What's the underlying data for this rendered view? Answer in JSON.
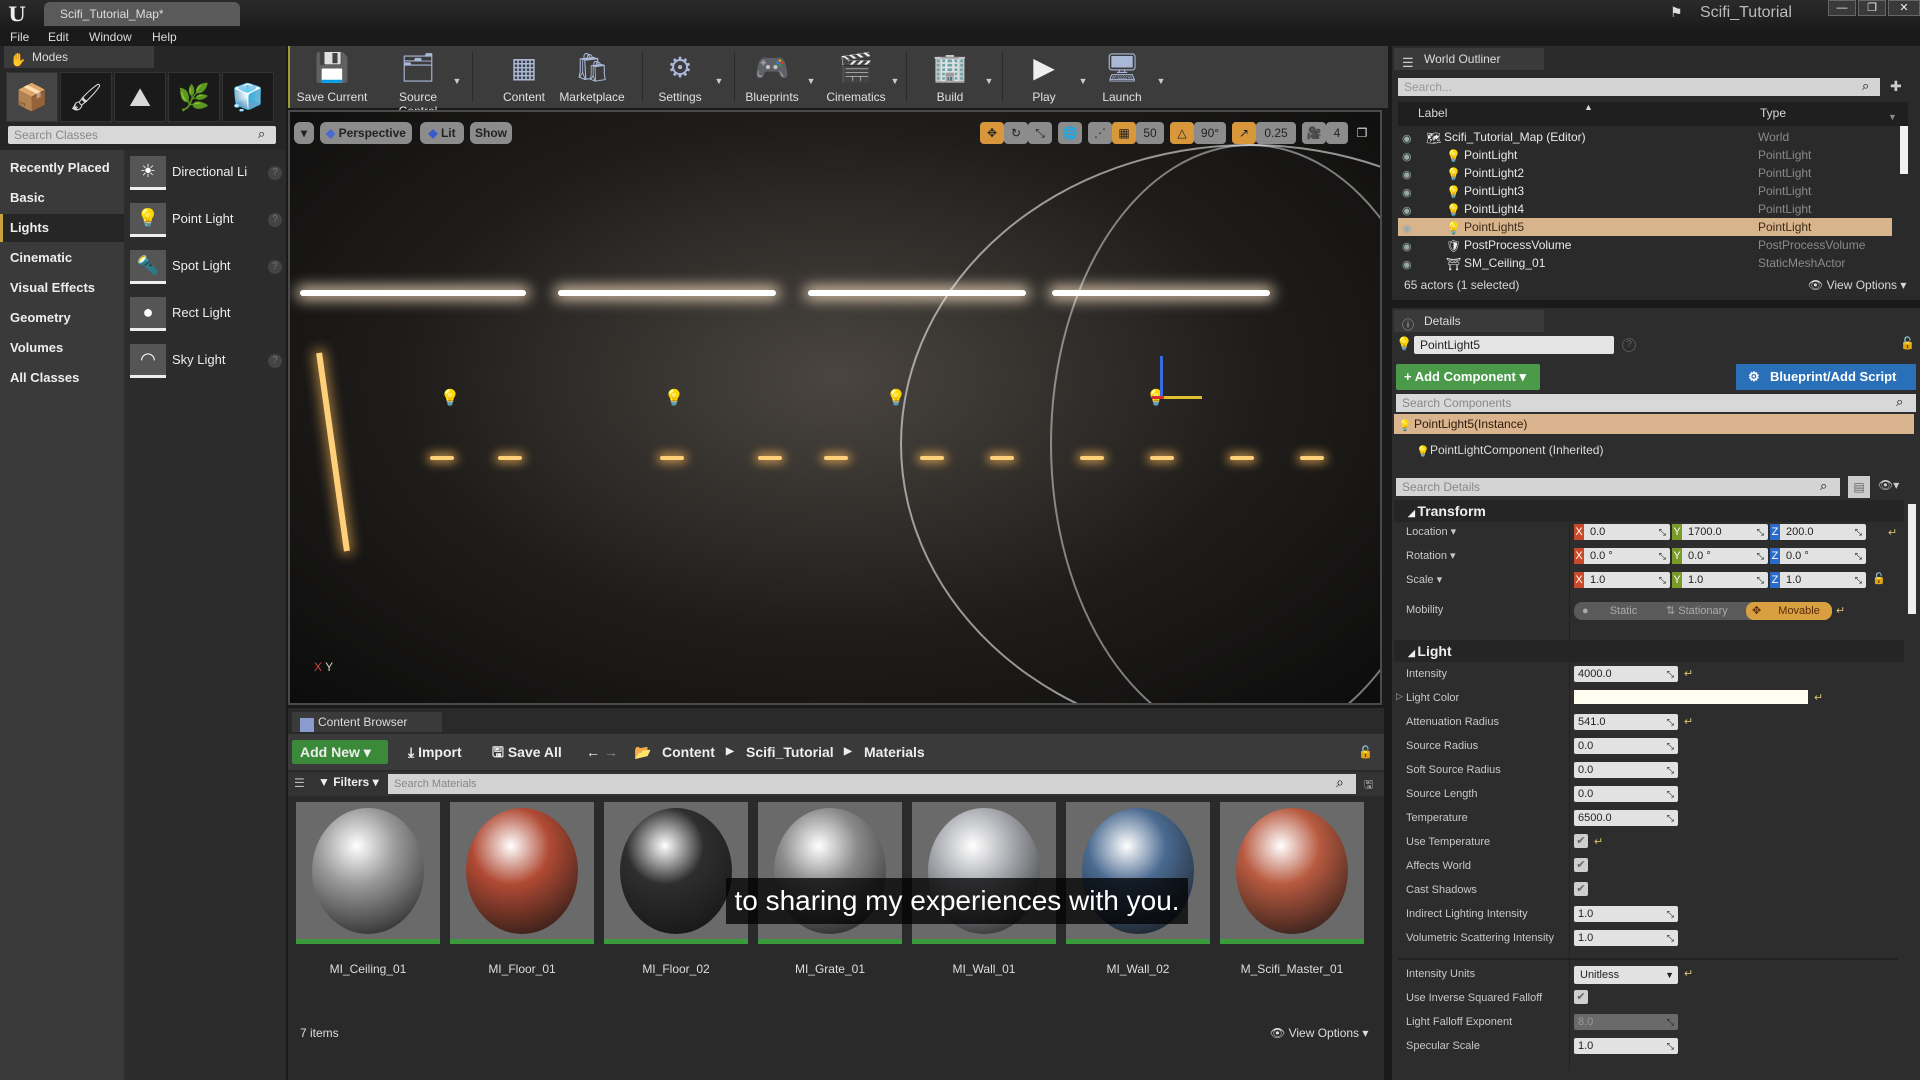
{
  "window": {
    "map_tab": "Scifi_Tutorial_Map*",
    "project_name": "Scifi_Tutorial",
    "controls": [
      "minimize",
      "maximize",
      "close"
    ]
  },
  "menu": [
    "File",
    "Edit",
    "Window",
    "Help"
  ],
  "modes": {
    "tab_label": "Modes",
    "mode_icons": [
      "place-mode-icon",
      "paint-mode-icon",
      "landscape-mode-icon",
      "foliage-mode-icon",
      "geometry-mode-icon"
    ],
    "search_placeholder": "Search Classes",
    "categories": [
      "Recently Placed",
      "Basic",
      "Lights",
      "Cinematic",
      "Visual Effects",
      "Geometry",
      "Volumes",
      "All Classes"
    ],
    "active_category": "Lights",
    "classes": [
      {
        "label": "Directional Li",
        "icon": "directional-light-icon",
        "help": true
      },
      {
        "label": "Point Light",
        "icon": "point-light-icon",
        "help": true
      },
      {
        "label": "Spot Light",
        "icon": "spot-light-icon",
        "help": true
      },
      {
        "label": "Rect Light",
        "icon": "rect-light-icon",
        "help": false
      },
      {
        "label": "Sky Light",
        "icon": "sky-light-icon",
        "help": true
      }
    ]
  },
  "toolbar": {
    "buttons": [
      {
        "label": "Save Current",
        "icon": "save-icon",
        "dropdown": false
      },
      {
        "label": "Source Control",
        "icon": "source-control-icon",
        "dropdown": true
      },
      {
        "label": "Content",
        "icon": "content-icon",
        "dropdown": false
      },
      {
        "label": "Marketplace",
        "icon": "marketplace-icon",
        "dropdown": false
      },
      {
        "label": "Settings",
        "icon": "settings-icon",
        "dropdown": true
      },
      {
        "label": "Blueprints",
        "icon": "blueprints-icon",
        "dropdown": true
      },
      {
        "label": "Cinematics",
        "icon": "cinematics-icon",
        "dropdown": true
      },
      {
        "label": "Build",
        "icon": "build-icon",
        "dropdown": true
      },
      {
        "label": "Play",
        "icon": "play-icon",
        "dropdown": true
      },
      {
        "label": "Launch",
        "icon": "launch-icon",
        "dropdown": true
      }
    ]
  },
  "viewport": {
    "view_mode": "Perspective",
    "lighting": "Lit",
    "show": "Show",
    "grid_snap": "50",
    "rotation_snap": "90°",
    "scale_snap": "0.25",
    "camera_speed": "4",
    "axis_label": "Y"
  },
  "content_browser": {
    "tab_label": "Content Browser",
    "add_new": "Add New",
    "import": "Import",
    "save_all": "Save All",
    "breadcrumb": [
      "Content",
      "Scifi_Tutorial",
      "Materials"
    ],
    "filters": "Filters",
    "search_placeholder": "Search Materials",
    "assets": [
      {
        "name": "MI_Ceiling_01",
        "color": "#9a9a9a"
      },
      {
        "name": "MI_Floor_01",
        "color": "#b04a34"
      },
      {
        "name": "MI_Floor_02",
        "color": "#2e2e2e"
      },
      {
        "name": "MI_Grate_01",
        "color": "#8a8a8a"
      },
      {
        "name": "MI_Wall_01",
        "color": "#a8aab0"
      },
      {
        "name": "MI_Wall_02",
        "color": "#4a6a90"
      },
      {
        "name": "M_Scifi_Master_01",
        "color": "#b85a40"
      }
    ],
    "item_count": "7 items",
    "view_options": "View Options"
  },
  "subtitle": "to sharing my experiences with you.",
  "outliner": {
    "tab_label": "World Outliner",
    "search_placeholder": "Search...",
    "columns": [
      "Label",
      "Type"
    ],
    "rows": [
      {
        "label": "Scifi_Tutorial_Map (Editor)",
        "type": "World",
        "selected": false,
        "indent": 0
      },
      {
        "label": "PointLight",
        "type": "PointLight",
        "selected": false,
        "indent": 1
      },
      {
        "label": "PointLight2",
        "type": "PointLight",
        "selected": false,
        "indent": 1
      },
      {
        "label": "PointLight3",
        "type": "PointLight",
        "selected": false,
        "indent": 1
      },
      {
        "label": "PointLight4",
        "type": "PointLight",
        "selected": false,
        "indent": 1
      },
      {
        "label": "PointLight5",
        "type": "PointLight",
        "selected": true,
        "indent": 1
      },
      {
        "label": "PostProcessVolume",
        "type": "PostProcessVolume",
        "selected": false,
        "indent": 1
      },
      {
        "label": "SM_Ceiling_01",
        "type": "StaticMeshActor",
        "selected": false,
        "indent": 1
      }
    ],
    "footer": "65 actors (1 selected)",
    "view_options": "View Options"
  },
  "details": {
    "tab_label": "Details",
    "actor_name": "PointLight5",
    "add_component": "+ Add Component",
    "blueprint_script": "Blueprint/Add Script",
    "search_components_placeholder": "Search Components",
    "component_instance": "PointLight5(Instance)",
    "component_inherited": "PointLightComponent (Inherited)",
    "search_details_placeholder": "Search Details",
    "transform": {
      "title": "Transform",
      "location": {
        "label": "Location",
        "x": "0.0",
        "y": "1700.0",
        "z": "200.0"
      },
      "rotation": {
        "label": "Rotation",
        "x": "0.0 °",
        "y": "0.0 °",
        "z": "0.0 °"
      },
      "scale": {
        "label": "Scale",
        "x": "1.0",
        "y": "1.0",
        "z": "1.0"
      },
      "mobility": {
        "label": "Mobility",
        "options": [
          "Static",
          "Stationary",
          "Movable"
        ],
        "selected": "Movable"
      }
    },
    "light": {
      "title": "Light",
      "intensity": {
        "label": "Intensity",
        "value": "4000.0"
      },
      "light_color": {
        "label": "Light Color",
        "value": "#fffdf0"
      },
      "attenuation_radius": {
        "label": "Attenuation Radius",
        "value": "541.0"
      },
      "source_radius": {
        "label": "Source Radius",
        "value": "0.0"
      },
      "soft_source_radius": {
        "label": "Soft Source Radius",
        "value": "0.0"
      },
      "source_length": {
        "label": "Source Length",
        "value": "0.0"
      },
      "temperature": {
        "label": "Temperature",
        "value": "6500.0"
      },
      "use_temperature": {
        "label": "Use Temperature",
        "checked": true
      },
      "affects_world": {
        "label": "Affects World",
        "checked": true
      },
      "cast_shadows": {
        "label": "Cast Shadows",
        "checked": true
      },
      "indirect_lighting_intensity": {
        "label": "Indirect Lighting Intensity",
        "value": "1.0"
      },
      "volumetric_scattering_intensity": {
        "label": "Volumetric Scattering Intensity",
        "value": "1.0"
      },
      "intensity_units": {
        "label": "Intensity Units",
        "value": "Unitless"
      },
      "use_inverse_squared_falloff": {
        "label": "Use Inverse Squared Falloff",
        "checked": true
      },
      "light_falloff_exponent": {
        "label": "Light Falloff Exponent",
        "value": "8.0"
      },
      "specular_scale": {
        "label": "Specular Scale",
        "value": "1.0"
      }
    }
  },
  "colors": {
    "accent_orange": "#d8a040",
    "selection": "#d8b48c",
    "add_green": "#4a9a4a",
    "blueprint_blue": "#2a70b8",
    "axis_x": "#c84a2a",
    "axis_y": "#7a9a2a",
    "axis_z": "#2a6ac8"
  }
}
